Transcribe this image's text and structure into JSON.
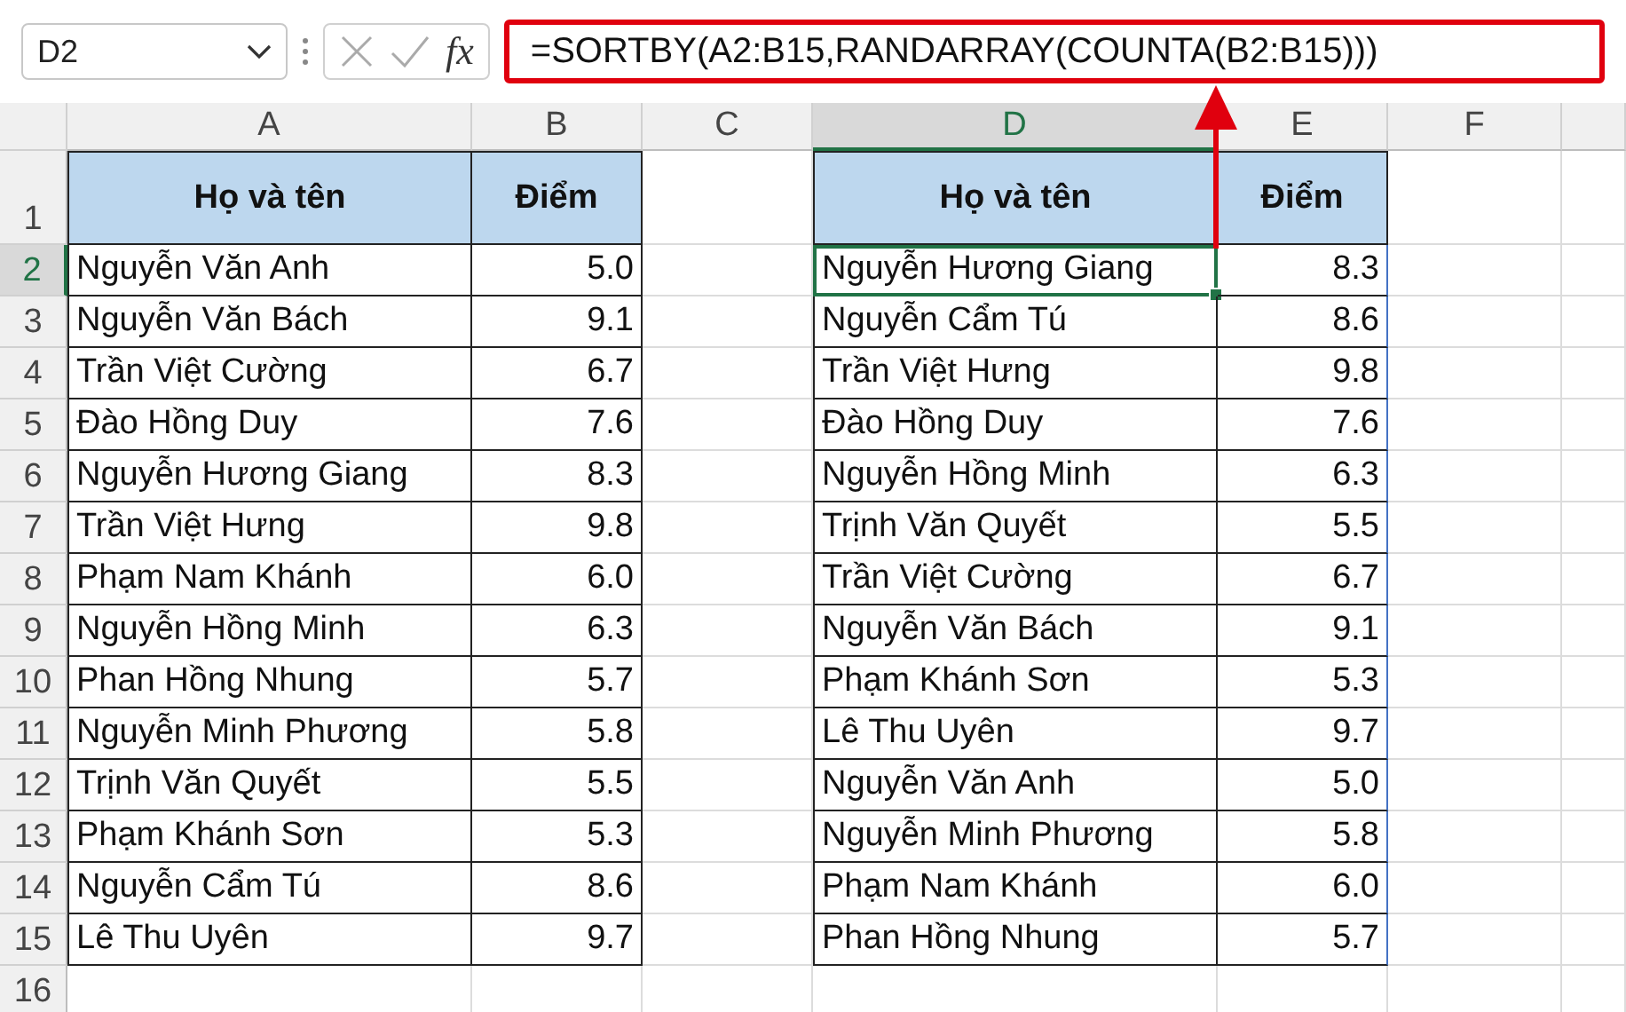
{
  "name_box": {
    "value": "D2"
  },
  "formula_bar": {
    "function_label": "fx",
    "formula": "=SORTBY(A2:B15,RANDARRAY(COUNTA(B2:B15)))",
    "highlighted": true
  },
  "columns": [
    {
      "label": "A",
      "selected": false
    },
    {
      "label": "B",
      "selected": false
    },
    {
      "label": "C",
      "selected": false
    },
    {
      "label": "D",
      "selected": true
    },
    {
      "label": "E",
      "selected": false
    },
    {
      "label": "F",
      "selected": false
    }
  ],
  "rows": [
    {
      "label": "1",
      "selected": false
    },
    {
      "label": "2",
      "selected": true
    },
    {
      "label": "3",
      "selected": false
    },
    {
      "label": "4",
      "selected": false
    },
    {
      "label": "5",
      "selected": false
    },
    {
      "label": "6",
      "selected": false
    },
    {
      "label": "7",
      "selected": false
    },
    {
      "label": "8",
      "selected": false
    },
    {
      "label": "9",
      "selected": false
    },
    {
      "label": "10",
      "selected": false
    },
    {
      "label": "11",
      "selected": false
    },
    {
      "label": "12",
      "selected": false
    },
    {
      "label": "13",
      "selected": false
    },
    {
      "label": "14",
      "selected": false
    },
    {
      "label": "15",
      "selected": false
    },
    {
      "label": "16",
      "selected": false
    }
  ],
  "tables": [
    {
      "headers": [
        "Họ và tên",
        "Điểm"
      ],
      "rows": [
        {
          "name": "Nguyễn Văn Anh",
          "score": "5.0",
          "selected": false
        },
        {
          "name": "Nguyễn Văn Bách",
          "score": "9.1",
          "selected": false
        },
        {
          "name": "Trần Việt Cường",
          "score": "6.7",
          "selected": false
        },
        {
          "name": "Đào Hồng Duy",
          "score": "7.6",
          "selected": false
        },
        {
          "name": "Nguyễn Hương Giang",
          "score": "8.3",
          "selected": false
        },
        {
          "name": "Trần Việt Hưng",
          "score": "9.8",
          "selected": false
        },
        {
          "name": "Phạm Nam Khánh",
          "score": "6.0",
          "selected": false
        },
        {
          "name": "Nguyễn Hồng Minh",
          "score": "6.3",
          "selected": false
        },
        {
          "name": "Phan Hồng Nhung",
          "score": "5.7",
          "selected": false
        },
        {
          "name": "Nguyễn Minh Phương",
          "score": "5.8",
          "selected": false
        },
        {
          "name": "Trịnh Văn Quyết",
          "score": "5.5",
          "selected": false
        },
        {
          "name": "Phạm Khánh Sơn",
          "score": "5.3",
          "selected": false
        },
        {
          "name": "Nguyễn Cẩm Tú",
          "score": "8.6",
          "selected": false
        },
        {
          "name": "Lê Thu Uyên",
          "score": "9.7",
          "selected": false
        }
      ]
    },
    {
      "headers": [
        "Họ và tên",
        "Điểm"
      ],
      "rows": [
        {
          "name": "Nguyễn Hương Giang",
          "score": "8.3",
          "selected": true
        },
        {
          "name": "Nguyễn Cẩm Tú",
          "score": "8.6",
          "selected": false
        },
        {
          "name": "Trần Việt Hưng",
          "score": "9.8",
          "selected": false
        },
        {
          "name": "Đào Hồng Duy",
          "score": "7.6",
          "selected": false
        },
        {
          "name": "Nguyễn Hồng Minh",
          "score": "6.3",
          "selected": false
        },
        {
          "name": "Trịnh Văn Quyết",
          "score": "5.5",
          "selected": false
        },
        {
          "name": "Trần Việt Cường",
          "score": "6.7",
          "selected": false
        },
        {
          "name": "Nguyễn Văn Bách",
          "score": "9.1",
          "selected": false
        },
        {
          "name": "Phạm Khánh Sơn",
          "score": "5.3",
          "selected": false
        },
        {
          "name": "Lê Thu Uyên",
          "score": "9.7",
          "selected": false
        },
        {
          "name": "Nguyễn Văn Anh",
          "score": "5.0",
          "selected": false
        },
        {
          "name": "Nguyễn Minh Phương",
          "score": "5.8",
          "selected": false
        },
        {
          "name": "Phạm Nam Khánh",
          "score": "6.0",
          "selected": false
        },
        {
          "name": "Phan Hồng Nhung",
          "score": "5.7",
          "selected": false
        }
      ]
    }
  ]
}
